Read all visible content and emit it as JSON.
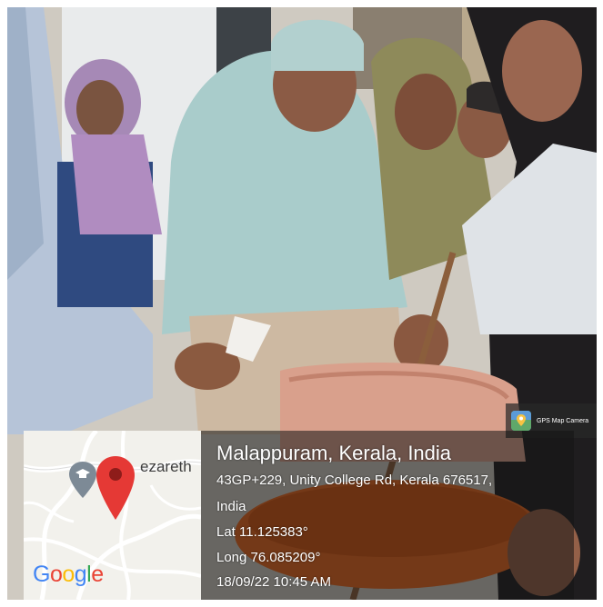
{
  "photo": {
    "badge_icon": "gps-map-camera-icon",
    "badge_text": "GPS Map Camera"
  },
  "map": {
    "place_label": "ezareth",
    "pin_icon": "location-pin-icon",
    "poi_icon": "school-poi-icon",
    "logo_text": "Google",
    "logo_colors": [
      "#4285F4",
      "#EA4335",
      "#FBBC05",
      "#4285F4",
      "#34A853",
      "#EA4335"
    ]
  },
  "location": {
    "title": "Malappuram, Kerala, India",
    "address_line1": "43GP+229, Unity College Rd, Kerala 676517,",
    "address_line2": "India",
    "lat": "Lat 11.125383°",
    "long": "Long 76.085209°",
    "datetime": "18/09/22 10:45 AM"
  },
  "colors": {
    "pin": "#E53935",
    "bucket": "#E8661E",
    "chair": "#D9A08C"
  }
}
